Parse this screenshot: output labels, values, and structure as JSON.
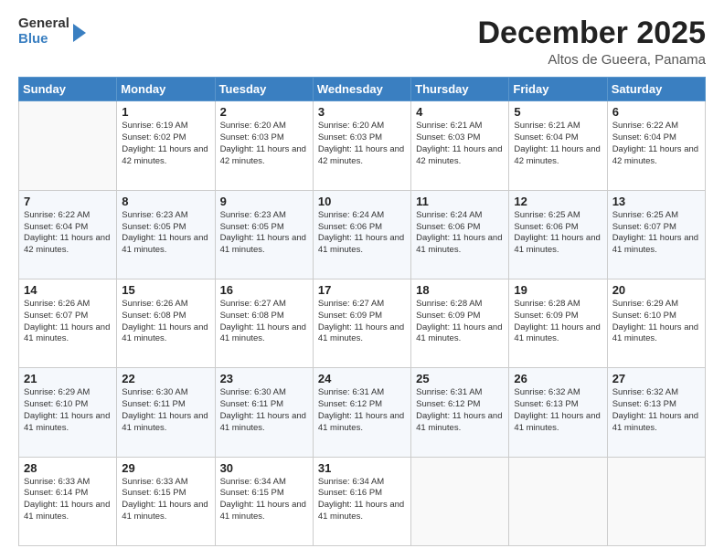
{
  "header": {
    "logo": {
      "line1": "General",
      "line2": "Blue"
    },
    "month_year": "December 2025",
    "location": "Altos de Gueera, Panama"
  },
  "weekdays": [
    "Sunday",
    "Monday",
    "Tuesday",
    "Wednesday",
    "Thursday",
    "Friday",
    "Saturday"
  ],
  "weeks": [
    [
      {
        "day": "",
        "sunrise": "",
        "sunset": "",
        "daylight": ""
      },
      {
        "day": "1",
        "sunrise": "Sunrise: 6:19 AM",
        "sunset": "Sunset: 6:02 PM",
        "daylight": "Daylight: 11 hours and 42 minutes."
      },
      {
        "day": "2",
        "sunrise": "Sunrise: 6:20 AM",
        "sunset": "Sunset: 6:03 PM",
        "daylight": "Daylight: 11 hours and 42 minutes."
      },
      {
        "day": "3",
        "sunrise": "Sunrise: 6:20 AM",
        "sunset": "Sunset: 6:03 PM",
        "daylight": "Daylight: 11 hours and 42 minutes."
      },
      {
        "day": "4",
        "sunrise": "Sunrise: 6:21 AM",
        "sunset": "Sunset: 6:03 PM",
        "daylight": "Daylight: 11 hours and 42 minutes."
      },
      {
        "day": "5",
        "sunrise": "Sunrise: 6:21 AM",
        "sunset": "Sunset: 6:04 PM",
        "daylight": "Daylight: 11 hours and 42 minutes."
      },
      {
        "day": "6",
        "sunrise": "Sunrise: 6:22 AM",
        "sunset": "Sunset: 6:04 PM",
        "daylight": "Daylight: 11 hours and 42 minutes."
      }
    ],
    [
      {
        "day": "7",
        "sunrise": "Sunrise: 6:22 AM",
        "sunset": "Sunset: 6:04 PM",
        "daylight": "Daylight: 11 hours and 42 minutes."
      },
      {
        "day": "8",
        "sunrise": "Sunrise: 6:23 AM",
        "sunset": "Sunset: 6:05 PM",
        "daylight": "Daylight: 11 hours and 41 minutes."
      },
      {
        "day": "9",
        "sunrise": "Sunrise: 6:23 AM",
        "sunset": "Sunset: 6:05 PM",
        "daylight": "Daylight: 11 hours and 41 minutes."
      },
      {
        "day": "10",
        "sunrise": "Sunrise: 6:24 AM",
        "sunset": "Sunset: 6:06 PM",
        "daylight": "Daylight: 11 hours and 41 minutes."
      },
      {
        "day": "11",
        "sunrise": "Sunrise: 6:24 AM",
        "sunset": "Sunset: 6:06 PM",
        "daylight": "Daylight: 11 hours and 41 minutes."
      },
      {
        "day": "12",
        "sunrise": "Sunrise: 6:25 AM",
        "sunset": "Sunset: 6:06 PM",
        "daylight": "Daylight: 11 hours and 41 minutes."
      },
      {
        "day": "13",
        "sunrise": "Sunrise: 6:25 AM",
        "sunset": "Sunset: 6:07 PM",
        "daylight": "Daylight: 11 hours and 41 minutes."
      }
    ],
    [
      {
        "day": "14",
        "sunrise": "Sunrise: 6:26 AM",
        "sunset": "Sunset: 6:07 PM",
        "daylight": "Daylight: 11 hours and 41 minutes."
      },
      {
        "day": "15",
        "sunrise": "Sunrise: 6:26 AM",
        "sunset": "Sunset: 6:08 PM",
        "daylight": "Daylight: 11 hours and 41 minutes."
      },
      {
        "day": "16",
        "sunrise": "Sunrise: 6:27 AM",
        "sunset": "Sunset: 6:08 PM",
        "daylight": "Daylight: 11 hours and 41 minutes."
      },
      {
        "day": "17",
        "sunrise": "Sunrise: 6:27 AM",
        "sunset": "Sunset: 6:09 PM",
        "daylight": "Daylight: 11 hours and 41 minutes."
      },
      {
        "day": "18",
        "sunrise": "Sunrise: 6:28 AM",
        "sunset": "Sunset: 6:09 PM",
        "daylight": "Daylight: 11 hours and 41 minutes."
      },
      {
        "day": "19",
        "sunrise": "Sunrise: 6:28 AM",
        "sunset": "Sunset: 6:09 PM",
        "daylight": "Daylight: 11 hours and 41 minutes."
      },
      {
        "day": "20",
        "sunrise": "Sunrise: 6:29 AM",
        "sunset": "Sunset: 6:10 PM",
        "daylight": "Daylight: 11 hours and 41 minutes."
      }
    ],
    [
      {
        "day": "21",
        "sunrise": "Sunrise: 6:29 AM",
        "sunset": "Sunset: 6:10 PM",
        "daylight": "Daylight: 11 hours and 41 minutes."
      },
      {
        "day": "22",
        "sunrise": "Sunrise: 6:30 AM",
        "sunset": "Sunset: 6:11 PM",
        "daylight": "Daylight: 11 hours and 41 minutes."
      },
      {
        "day": "23",
        "sunrise": "Sunrise: 6:30 AM",
        "sunset": "Sunset: 6:11 PM",
        "daylight": "Daylight: 11 hours and 41 minutes."
      },
      {
        "day": "24",
        "sunrise": "Sunrise: 6:31 AM",
        "sunset": "Sunset: 6:12 PM",
        "daylight": "Daylight: 11 hours and 41 minutes."
      },
      {
        "day": "25",
        "sunrise": "Sunrise: 6:31 AM",
        "sunset": "Sunset: 6:12 PM",
        "daylight": "Daylight: 11 hours and 41 minutes."
      },
      {
        "day": "26",
        "sunrise": "Sunrise: 6:32 AM",
        "sunset": "Sunset: 6:13 PM",
        "daylight": "Daylight: 11 hours and 41 minutes."
      },
      {
        "day": "27",
        "sunrise": "Sunrise: 6:32 AM",
        "sunset": "Sunset: 6:13 PM",
        "daylight": "Daylight: 11 hours and 41 minutes."
      }
    ],
    [
      {
        "day": "28",
        "sunrise": "Sunrise: 6:33 AM",
        "sunset": "Sunset: 6:14 PM",
        "daylight": "Daylight: 11 hours and 41 minutes."
      },
      {
        "day": "29",
        "sunrise": "Sunrise: 6:33 AM",
        "sunset": "Sunset: 6:15 PM",
        "daylight": "Daylight: 11 hours and 41 minutes."
      },
      {
        "day": "30",
        "sunrise": "Sunrise: 6:34 AM",
        "sunset": "Sunset: 6:15 PM",
        "daylight": "Daylight: 11 hours and 41 minutes."
      },
      {
        "day": "31",
        "sunrise": "Sunrise: 6:34 AM",
        "sunset": "Sunset: 6:16 PM",
        "daylight": "Daylight: 11 hours and 41 minutes."
      },
      {
        "day": "",
        "sunrise": "",
        "sunset": "",
        "daylight": ""
      },
      {
        "day": "",
        "sunrise": "",
        "sunset": "",
        "daylight": ""
      },
      {
        "day": "",
        "sunrise": "",
        "sunset": "",
        "daylight": ""
      }
    ]
  ]
}
